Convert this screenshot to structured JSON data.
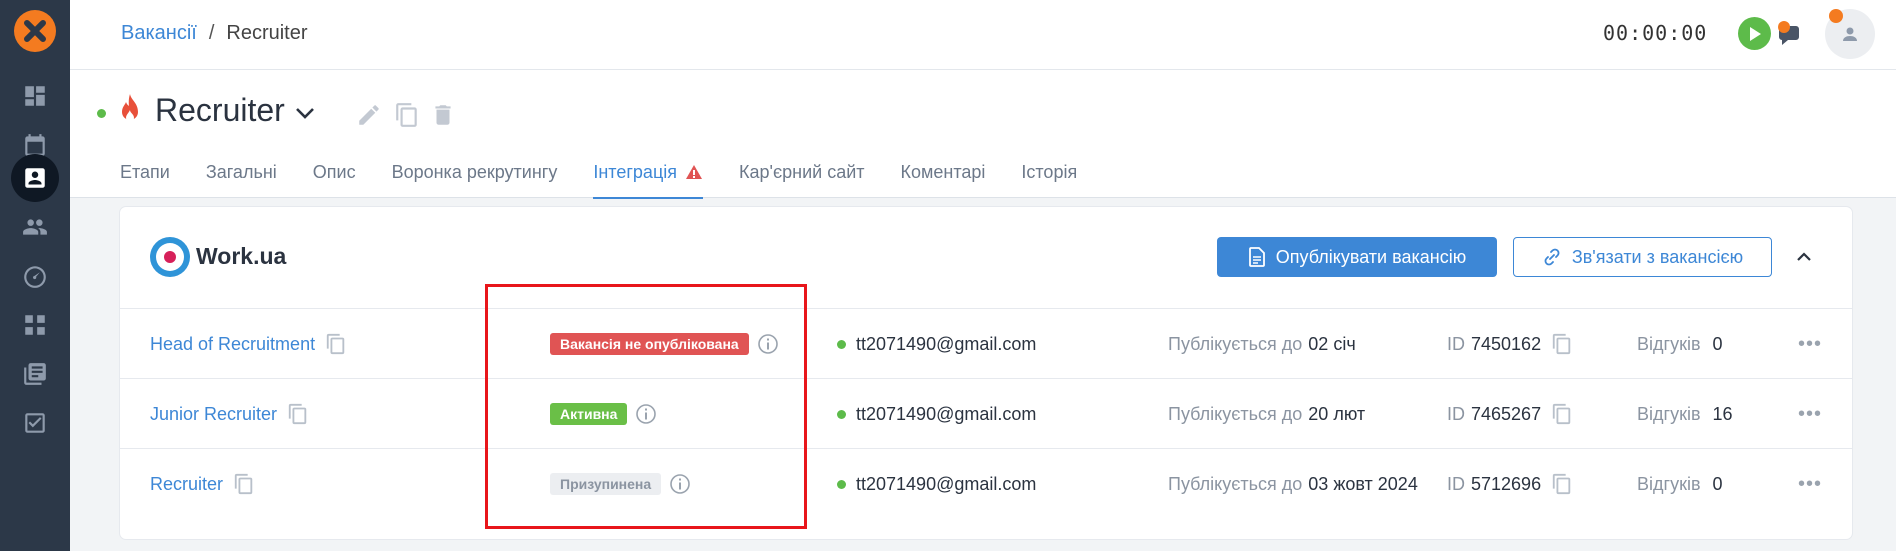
{
  "colors": {
    "accent": "#3d87d6",
    "sidebar_bg": "#2c3848",
    "brand_orange": "#f47b20",
    "status_green": "#5dbb4a",
    "danger_red": "#e05454",
    "annotation_red": "#e8161b"
  },
  "sidebar": {
    "items": [
      {
        "icon": "dashboard-icon"
      },
      {
        "icon": "calendar-icon"
      },
      {
        "icon": "vacancies-icon",
        "active": true
      },
      {
        "icon": "candidates-icon"
      },
      {
        "icon": "speedometer-icon"
      },
      {
        "icon": "workflow-icon"
      },
      {
        "icon": "library-icon"
      },
      {
        "icon": "tasks-icon"
      }
    ]
  },
  "topbar": {
    "breadcrumb": {
      "parent": "Вакансії",
      "separator": "/",
      "current": "Recruiter"
    },
    "timer": "00:00:00"
  },
  "header": {
    "title": "Recruiter",
    "tabs": [
      {
        "label": "Етапи"
      },
      {
        "label": "Загальні"
      },
      {
        "label": "Опис"
      },
      {
        "label": "Воронка рекрутингу"
      },
      {
        "label": "Інтеграція",
        "active": true,
        "warning": true
      },
      {
        "label": "Кар'єрний сайт"
      },
      {
        "label": "Коментарі"
      },
      {
        "label": "Історія"
      }
    ]
  },
  "integration": {
    "provider": "Work.ua",
    "publish_button": "Опублікувати вакансію",
    "link_button": "Зв'язати з вакансією",
    "publish_prefix": "Публікується до",
    "id_prefix": "ID",
    "responses_prefix": "Відгуків",
    "rows": [
      {
        "name": "Head of Recruitment",
        "status": "Вакансія не опублікована",
        "status_type": "red",
        "email": "tt2071490@gmail.com",
        "publish_until": "02 січ",
        "id": "7450162",
        "responses": "0"
      },
      {
        "name": "Junior Recruiter",
        "status": "Активна",
        "status_type": "green",
        "email": "tt2071490@gmail.com",
        "publish_until": "20 лют",
        "id": "7465267",
        "responses": "16"
      },
      {
        "name": "Recruiter",
        "status": "Призупинена",
        "status_type": "gray",
        "email": "tt2071490@gmail.com",
        "publish_until": "03 жовт 2024",
        "id": "5712696",
        "responses": "0"
      }
    ]
  }
}
